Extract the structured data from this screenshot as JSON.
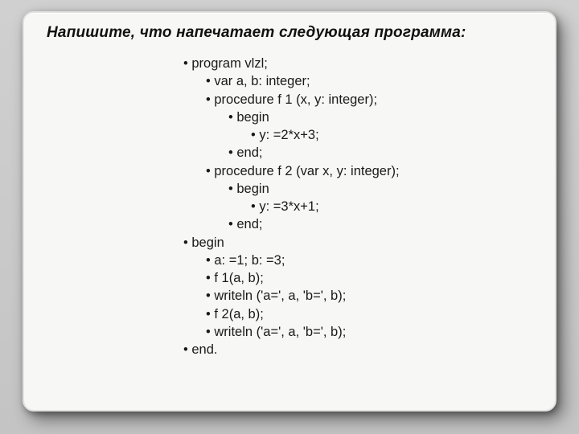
{
  "title": "Напишите, что напечатает следующая программа:",
  "lines": [
    {
      "lvl": 0,
      "text": "program vlzl;"
    },
    {
      "lvl": 1,
      "text": "var a, b: integer;"
    },
    {
      "lvl": 1,
      "text": "procedure f 1 (x, y: integer);"
    },
    {
      "lvl": 2,
      "text": "begin"
    },
    {
      "lvl": 3,
      "text": "y: =2*x+3;"
    },
    {
      "lvl": 2,
      "text": "end;"
    },
    {
      "lvl": 1,
      "text": "procedure f 2 (var x, y: integer);"
    },
    {
      "lvl": 2,
      "text": "begin"
    },
    {
      "lvl": 3,
      "text": "y: =3*x+1;"
    },
    {
      "lvl": 2,
      "text": "end;"
    },
    {
      "lvl": 0,
      "text": "begin"
    },
    {
      "lvl": 1,
      "text": "a: =1; b: =3;"
    },
    {
      "lvl": 1,
      "text": "f 1(a, b);"
    },
    {
      "lvl": 1,
      "text": "writeln ('a=', a, 'b=', b);"
    },
    {
      "lvl": 1,
      "text": "f 2(a, b);"
    },
    {
      "lvl": 1,
      "text": "writeln ('a=', a, 'b=', b);"
    },
    {
      "lvl": 0,
      "text": "end."
    }
  ]
}
